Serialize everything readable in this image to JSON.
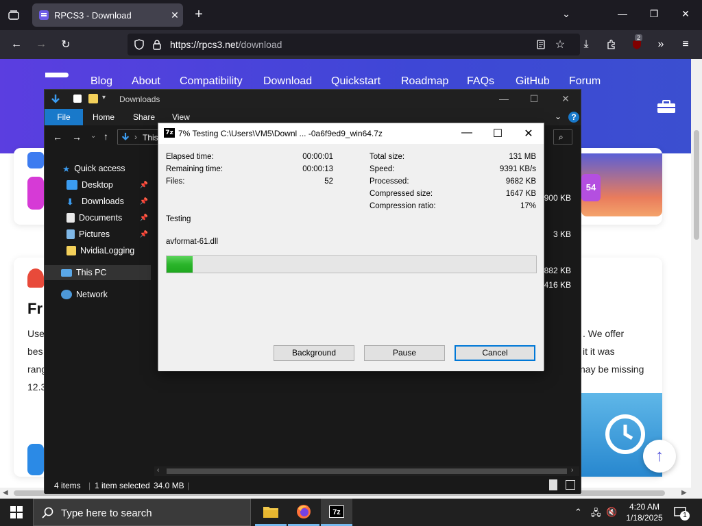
{
  "browser": {
    "tab_title": "RPCS3 - Download",
    "url_main": "https://rpcs3.net",
    "url_path": "/download",
    "extension_badge": "2"
  },
  "site": {
    "nav": [
      "Blog",
      "About",
      "Compatibility",
      "Download",
      "Quickstart",
      "Roadmap",
      "FAQs",
      "GitHub",
      "Forum"
    ],
    "sizes": [
      "900 KB",
      "3 KB",
      "882 KB",
      "416 KB"
    ],
    "partial_heading": "Fr",
    "text_left": [
      "Use",
      "bes",
      "rang",
      "12.3"
    ],
    "text_right": [
      ". We offer",
      "it it was",
      "nay be missing"
    ],
    "badge_54": "54"
  },
  "explorer": {
    "title": "Downloads",
    "ribbon_tabs": [
      "File",
      "Home",
      "Share",
      "View"
    ],
    "address": "This",
    "nav": {
      "quick_access": "Quick access",
      "desktop": "Desktop",
      "downloads": "Downloads",
      "documents": "Documents",
      "pictures": "Pictures",
      "nvidia": "NvidiaLogging",
      "this_pc": "This PC",
      "network": "Network"
    },
    "status": {
      "items": "4 items",
      "selected": "1 item selected",
      "size": "34.0 MB"
    }
  },
  "dialog": {
    "icon_label": "7z",
    "title": "7% Testing C:\\Users\\VM5\\Downl ... -0a6f9ed9_win64.7z",
    "left": {
      "elapsed_label": "Elapsed time:",
      "elapsed": "00:00:01",
      "remaining_label": "Remaining time:",
      "remaining": "00:00:13",
      "files_label": "Files:",
      "files": "52"
    },
    "right": {
      "total_label": "Total size:",
      "total": "131 MB",
      "speed_label": "Speed:",
      "speed": "9391 KB/s",
      "processed_label": "Processed:",
      "processed": "9682 KB",
      "compressed_label": "Compressed size:",
      "compressed": "1647 KB",
      "ratio_label": "Compression ratio:",
      "ratio": "17%"
    },
    "operation": "Testing",
    "current_file": "avformat-61.dll",
    "progress_fraction": 0.07,
    "buttons": {
      "background": "Background",
      "pause": "Pause",
      "cancel": "Cancel"
    }
  },
  "taskbar": {
    "search_placeholder": "Type here to search",
    "time": "4:20 AM",
    "date": "1/18/2025",
    "notification_count": "1",
    "apps": [
      "file-explorer",
      "firefox",
      "7-zip"
    ]
  },
  "colors": {
    "hero_gradient_start": "#5b3ee0",
    "hero_gradient_end": "#3b4fd0",
    "progress_green": "#2bb52b",
    "accent_blue": "#0078d7"
  }
}
